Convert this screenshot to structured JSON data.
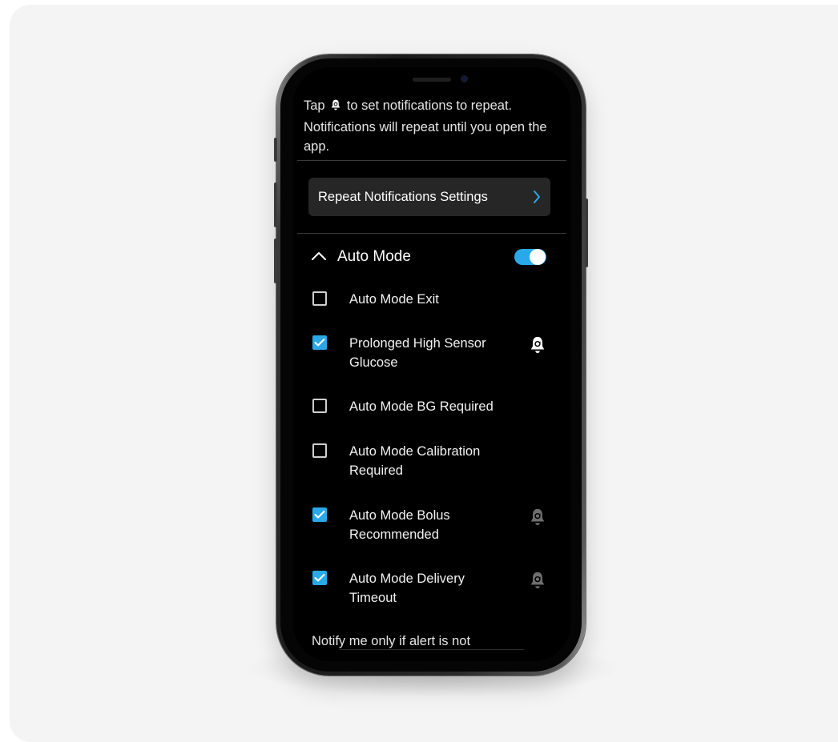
{
  "intro": {
    "before_icon": "Tap ",
    "icon": "bell-repeat-icon",
    "after_icon": " to set notifications to repeat. Notifications will repeat until you open the app."
  },
  "repeat_settings": {
    "label": "Repeat Notifications Settings",
    "icon": "chevron-right-icon"
  },
  "section": {
    "title": "Auto Mode",
    "expanded": true,
    "toggle_on": true,
    "icon": "chevron-up-icon"
  },
  "alerts": [
    {
      "label": "Auto Mode Exit",
      "checked": false,
      "bell": "none"
    },
    {
      "label": "Prolonged High Sensor Glucose",
      "checked": true,
      "bell": "active"
    },
    {
      "label": "Auto Mode BG Required",
      "checked": false,
      "bell": "none"
    },
    {
      "label": "Auto Mode Calibration Required",
      "checked": false,
      "bell": "none"
    },
    {
      "label": "Auto Mode Bolus Recommended",
      "checked": true,
      "bell": "inactive"
    },
    {
      "label": "Auto Mode Delivery Timeout",
      "checked": true,
      "bell": "inactive"
    }
  ],
  "footer": {
    "text": "Notify me only if alert is not"
  },
  "colors": {
    "accent": "#2aa9ea",
    "screen_bg": "#000000",
    "button_bg": "#262626",
    "bell_active": "#ffffff",
    "bell_inactive": "#6e6e6e"
  }
}
